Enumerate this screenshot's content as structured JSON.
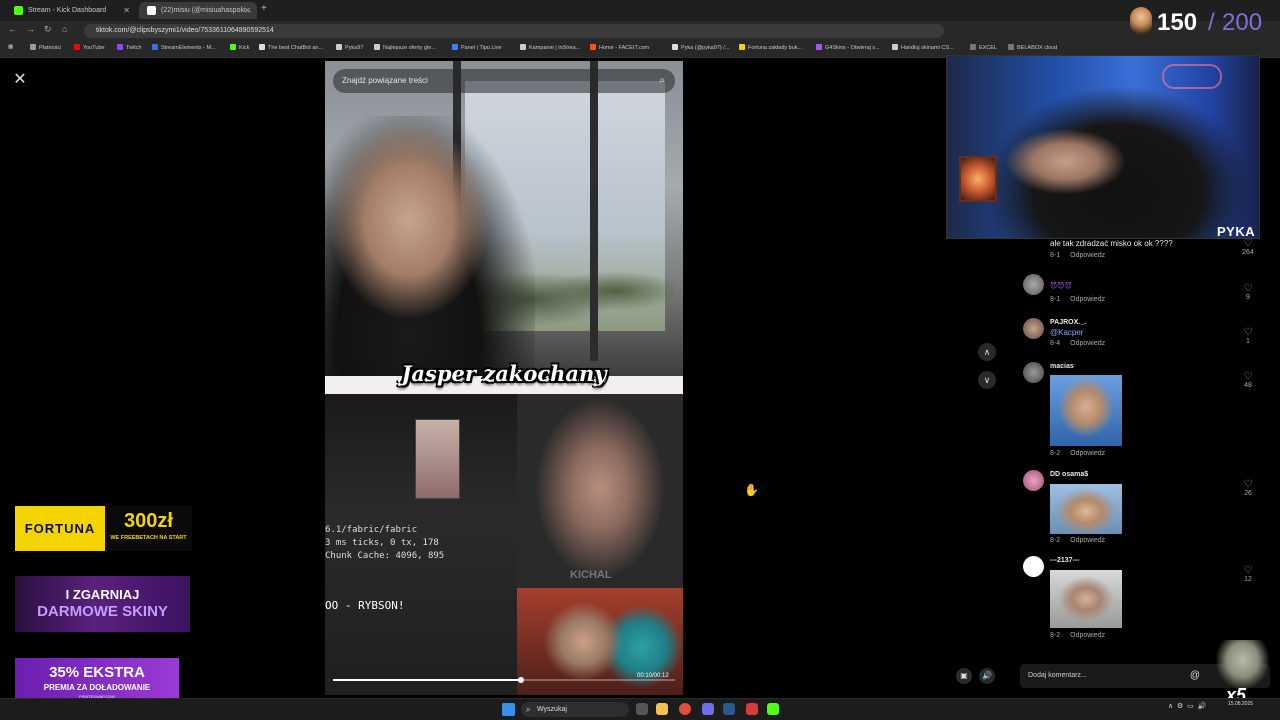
{
  "browser": {
    "tabs": [
      {
        "title": "Stream - Kick Dashboard",
        "color": "#53fc18"
      },
      {
        "title": "(22)misiu (@misiuahaspoki...",
        "color": "#ffffff"
      }
    ],
    "url": "tiktok.com/@clipsbyszymi1/video/7533611064890592514",
    "bookmarks": [
      {
        "label": "Płatności",
        "color": "#999999"
      },
      {
        "label": "YouTube",
        "color": "#ff0000"
      },
      {
        "label": "Twitch",
        "color": "#9146ff"
      },
      {
        "label": "StreamElements - M...",
        "color": "#3c6cf2"
      },
      {
        "label": "Kick",
        "color": "#53fc18"
      },
      {
        "label": "The best ChatBot an...",
        "color": "#dddddd"
      },
      {
        "label": "Pyka97",
        "color": "#cccccc"
      },
      {
        "label": "Najlepsze oferty gie...",
        "color": "#cccccc"
      },
      {
        "label": "Panel | Tipo.Live",
        "color": "#3b82f6"
      },
      {
        "label": "Kampanie | inStrea...",
        "color": "#cccccc"
      },
      {
        "label": "Home - FACEIT.com",
        "color": "#ff5500"
      },
      {
        "label": "Pyka (@pyka97) /...",
        "color": "#dddddd"
      },
      {
        "label": "Fortuna zakłady buk...",
        "color": "#f4d400"
      },
      {
        "label": "G4Skins - Otwieraj s...",
        "color": "#a855f7"
      },
      {
        "label": "Handluj skinami CS...",
        "color": "#cccccc"
      },
      {
        "label": "EXCEL",
        "color": "#777777"
      },
      {
        "label": "BELABOX cloud",
        "color": "#777777"
      }
    ]
  },
  "video": {
    "search_placeholder": "Znajdź powiązane treści",
    "caption": "Jasper zakochany",
    "terminal_lines": [
      "6.1/fabric/fabric",
      "3 ms ticks, 0 tx, 178",
      "Chunk Cache: 4096, 895"
    ],
    "banner_text": "OO - RYBSON!",
    "watermark": "KICHAL",
    "timestamp": "00:10/00:12",
    "progress": 0.55
  },
  "overlay": {
    "counter_current": "150",
    "counter_separator": "/",
    "counter_goal": "200",
    "streamer_name": "PYKA"
  },
  "comments": [
    {
      "user": "",
      "text": "ale tak zdradzać misko ok ok ????",
      "date": "8-1",
      "reply": "Odpowiedz",
      "likes": "264",
      "image": false
    },
    {
      "user": "",
      "text": "😈😈😈",
      "date": "8-1",
      "reply": "Odpowiedz",
      "likes": "9",
      "image": false
    },
    {
      "user": "PAJROX._.",
      "text": "@Kacper",
      "date": "8-4",
      "reply": "Odpowiedz",
      "likes": "1",
      "image": false
    },
    {
      "user": "macias",
      "text": "",
      "date": "8-2",
      "reply": "Odpowiedz",
      "likes": "48",
      "image": true
    },
    {
      "user": "DD osama$",
      "text": "",
      "date": "8-2",
      "reply": "Odpowiedz",
      "likes": "26",
      "image": true
    },
    {
      "user": "---2137---",
      "text": "",
      "date": "8-2",
      "reply": "Odpowiedz",
      "likes": "12",
      "image": true
    }
  ],
  "comment_input_placeholder": "Dodaj komentarz...",
  "icons": {
    "close": "✕",
    "search": "⌕",
    "up": "∧",
    "down": "∨",
    "heart": "♡",
    "at": "@",
    "volume": "🔊",
    "cursor": "✋"
  },
  "ads": {
    "fortuna_brand": "FORTUNA",
    "fortuna_amount": "300zł",
    "fortuna_sub": "WE FREEBETACH NA START",
    "skins_line1": "I ZGARNIAJ",
    "skins_line2": "DARMOWE SKINY",
    "pirate_line1": "35% EKSTRA",
    "pirate_line2": "PREMIA ZA DOŁADOWANIE",
    "pirate_line3": "PIRATESWAP.COM"
  },
  "emote_multiplier": "x5",
  "taskbar": {
    "search_label": "Wyszukaj",
    "date": "15.08.2025"
  }
}
